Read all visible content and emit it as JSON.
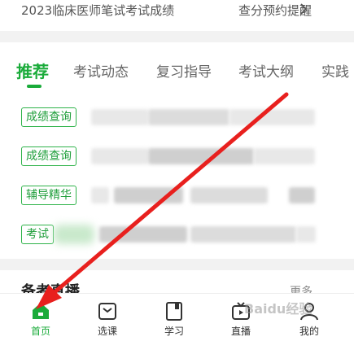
{
  "banner": {
    "title": "2023临床医师笔试考试成绩",
    "link": "查分预约提醒"
  },
  "tabs": [
    {
      "label": "推荐",
      "active": true
    },
    {
      "label": "考试动态"
    },
    {
      "label": "复习指导"
    },
    {
      "label": "考试大纲"
    },
    {
      "label": "实践"
    }
  ],
  "news": [
    {
      "tag": "成绩查询"
    },
    {
      "tag": "成绩查询"
    },
    {
      "tag": "辅导精华"
    },
    {
      "tag": "考试"
    }
  ],
  "section": {
    "title": "备考直播",
    "more": "更多"
  },
  "bottom_nav": [
    {
      "label": "首页",
      "icon": "home-icon",
      "active": true
    },
    {
      "label": "选课",
      "icon": "courses-icon"
    },
    {
      "label": "学习",
      "icon": "study-icon"
    },
    {
      "label": "直播",
      "icon": "live-tv-icon"
    },
    {
      "label": "我的",
      "icon": "profile-icon"
    }
  ],
  "colors": {
    "accent": "#1aab3a",
    "annotation_arrow": "#e8201e"
  },
  "watermark": "Baidu经验"
}
